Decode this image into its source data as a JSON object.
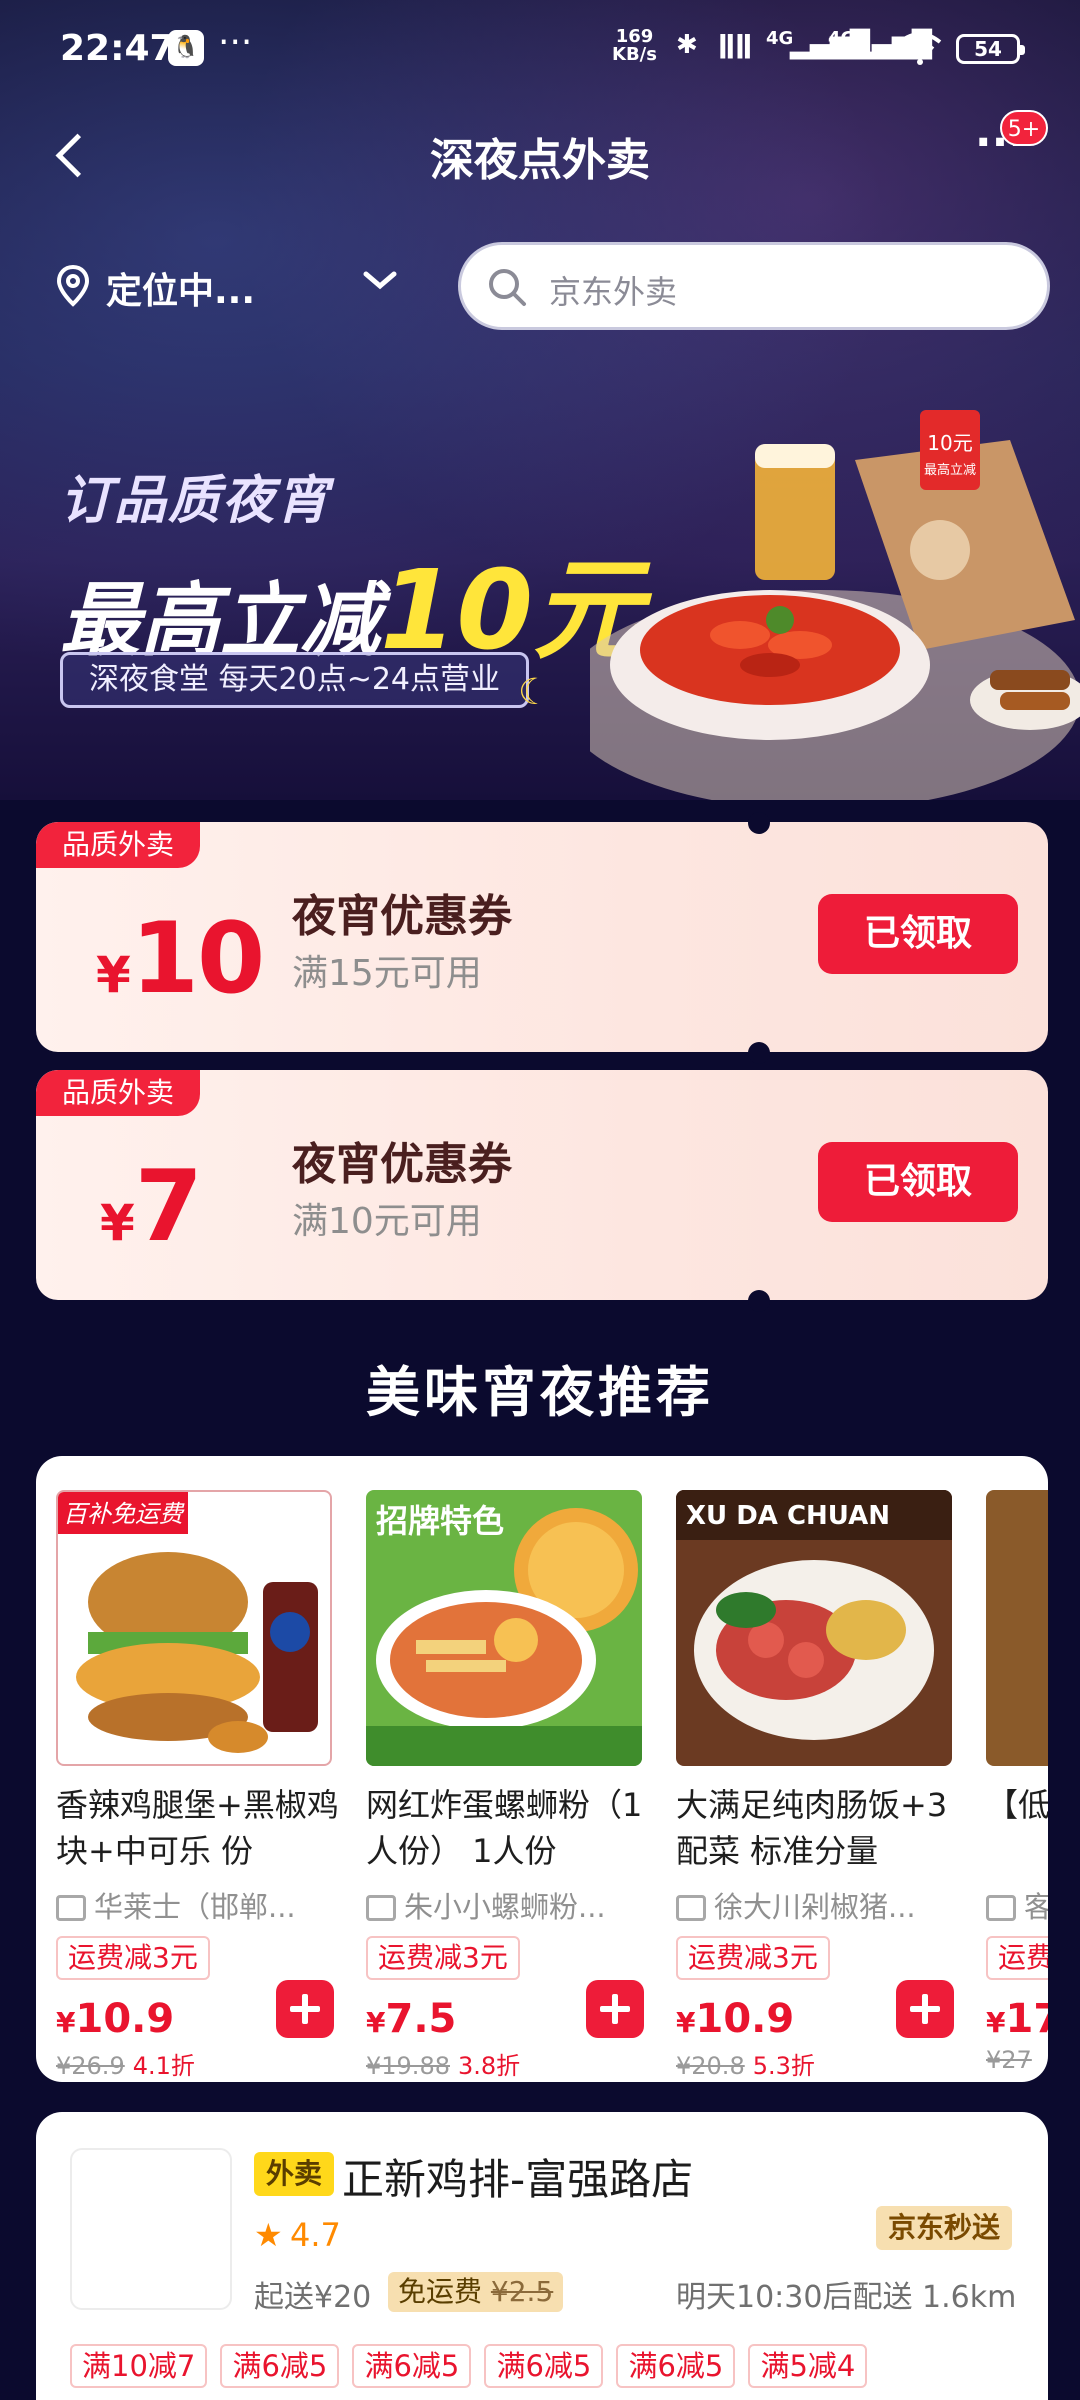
{
  "status_bar": {
    "time": "22:47",
    "menu_dots": "···",
    "net_speed_value": "169",
    "net_speed_unit": "KB/s",
    "signal_1": "4G",
    "signal_2": "4G",
    "battery": "54"
  },
  "nav": {
    "title": "深夜点外卖",
    "more": "···",
    "badge": "5+"
  },
  "location": {
    "label": "定位中..."
  },
  "search": {
    "placeholder": "京东外卖"
  },
  "banner": {
    "line1": "订品质夜宵",
    "line2_prefix": "最高立减",
    "line2_amount": "10元",
    "pill": "深夜食堂 每天20点~24点营业",
    "bag_text_1": "10元",
    "bag_text_2": "最高立减"
  },
  "coupons": [
    {
      "tag": "品质外卖",
      "currency": "¥",
      "amount": "10",
      "title": "夜宵优惠券",
      "condition": "满15元可用",
      "button": "已领取"
    },
    {
      "tag": "品质外卖",
      "currency": "¥",
      "amount": "7",
      "title": "夜宵优惠券",
      "condition": "满10元可用",
      "button": "已领取"
    }
  ],
  "section_title": "美味宵夜推荐",
  "products": [
    {
      "name": "香辣鸡腿堡+黑椒鸡块+中可乐 份",
      "shop": "华莱士（邯郸...",
      "tag": "运费减3元",
      "currency": "¥",
      "price": "10.9",
      "original": "¥26.9",
      "discount": "4.1折",
      "image_label": "百补免运费"
    },
    {
      "name": "网红炸蛋螺蛳粉（1人份） 1人份",
      "shop": "朱小小螺蛳粉...",
      "tag": "运费减3元",
      "currency": "¥",
      "price": "7.5",
      "original": "¥19.88",
      "discount": "3.8折",
      "image_label": "招牌特色"
    },
    {
      "name": "大满足纯肉肠饭+3配菜 标准分量",
      "shop": "徐大川剁椒猪...",
      "tag": "运费减3元",
      "currency": "¥",
      "price": "10.9",
      "original": "¥20.8",
      "discount": "5.3折",
      "image_label": "XU DA CHUAN"
    },
    {
      "name": "【低卤香",
      "shop": "客",
      "tag": "运费",
      "currency": "¥",
      "price": "17",
      "original": "¥27",
      "discount": "",
      "image_label": ""
    }
  ],
  "store": {
    "type_tag": "外卖",
    "name": "正新鸡排-富强路店",
    "rating": "4.7",
    "jd_tag": "京东秒送",
    "min_order": "起送¥20",
    "free_ship": "免运费",
    "free_ship_original": "¥2.5",
    "delivery": "明天10:30后配送  1.6km",
    "promos": [
      "满10减7",
      "满6减5",
      "满6减5",
      "满6减5",
      "满6减5",
      "满5减4"
    ]
  }
}
